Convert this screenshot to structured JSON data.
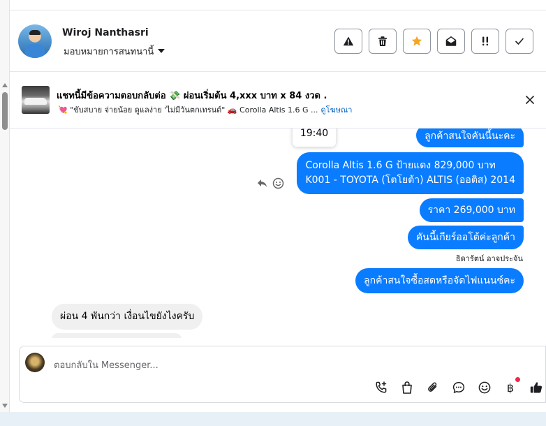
{
  "header": {
    "contact_name": "Wiroj Nanthasri",
    "assign_label": "มอบหมายการสนทนานี้",
    "actions": [
      "report-icon",
      "trash-icon",
      "star-icon",
      "mark-unread-icon",
      "priority-icon",
      "done-icon"
    ]
  },
  "ad": {
    "title": "แชทนี้มีข้อความตอบกลับต่อ 💸 ผ่อนเริ่มต้น 4,xxx บาท x 84 งวด .",
    "snippet": "💘 \"ขับสบาย จ่ายน้อย ดูแลง่าย 'ไม่มีวันตกเทรนด์\" 🚗 Corolla Altis 1.6 G ...",
    "link_label": "ดูโฆษณา"
  },
  "chat": {
    "timestamp": "19:40",
    "messages": [
      {
        "dir": "out",
        "text": "ลูกค้าสนใจคันนี้นะคะ"
      },
      {
        "dir": "out",
        "line1": "Corolla Altis 1.6 G ป้ายแดง 829,000 บาท",
        "line2": "K001 - TOYOTA (โตโยต้า) ALTIS (ออติส) 2014"
      },
      {
        "dir": "out",
        "text": "ราคา 269,000 บาท"
      },
      {
        "dir": "out",
        "text": "คันนี้เกียร์ออโต้ค่ะลูกค้า"
      },
      {
        "dir": "out",
        "text": "ลูกค้าสนใจซื้อสดหรือจัดไฟแนนซ์คะ",
        "sender": "ธิดารัตน์ อาจประจัน"
      },
      {
        "dir": "in",
        "text": "ผ่อน 4 พันกว่า เงื่อนไขยังไงครับ"
      }
    ]
  },
  "composer": {
    "placeholder": "ตอบกลับใน Messenger...",
    "tools": [
      "call-add-icon",
      "shopping-bag-icon",
      "attachment-icon",
      "comment-icon",
      "emoji-icon",
      "baht-icon",
      "like-icon"
    ],
    "baht_symbol": "฿"
  },
  "colors": {
    "outgoing_bubble": "#0a7cff",
    "incoming_bubble": "#f0f0f0",
    "star": "#f5a623",
    "link": "#0a66c2",
    "notification_dot": "#f02849"
  }
}
